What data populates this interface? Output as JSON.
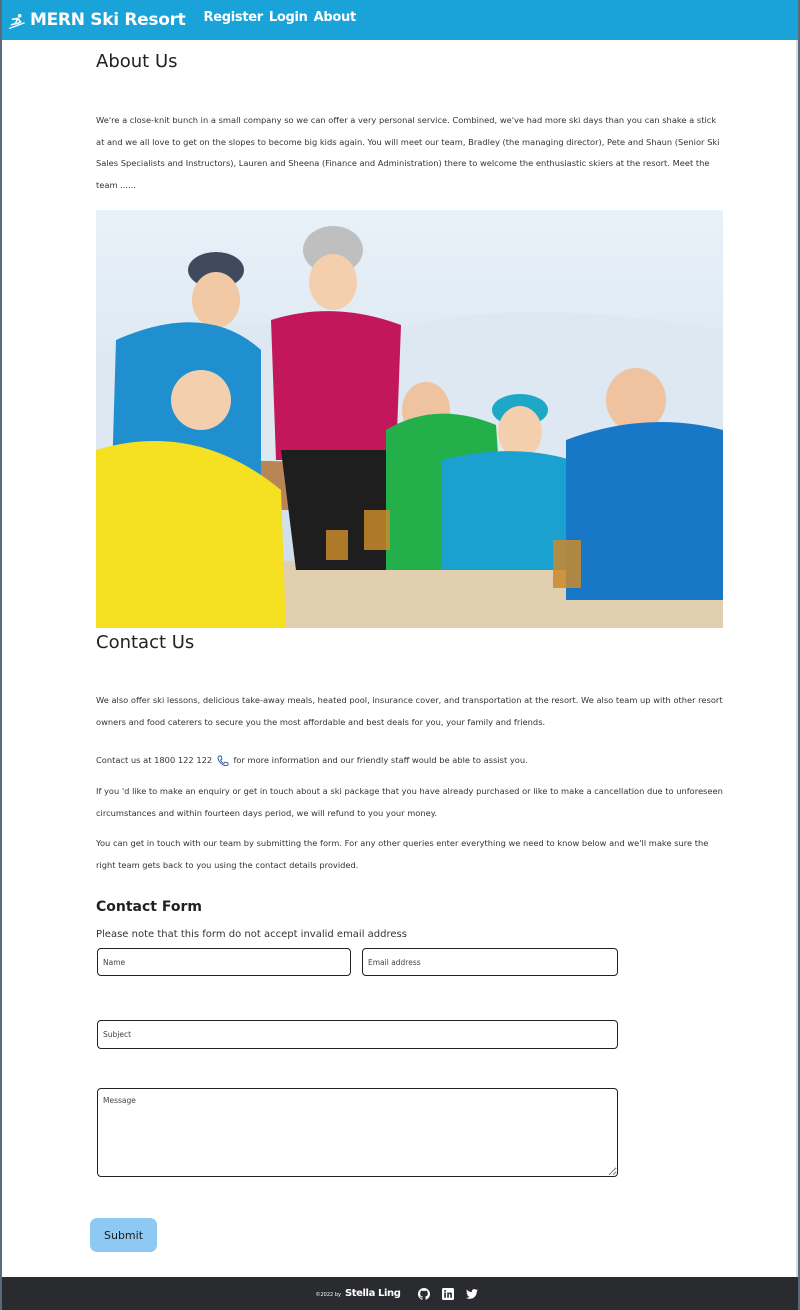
{
  "header": {
    "brand": "MERN Ski Resort",
    "brand_icon": "skier-icon",
    "nav": [
      "Register",
      "Login",
      "About"
    ],
    "colors": {
      "navbar": "#19a3d9"
    }
  },
  "about": {
    "title": "About Us",
    "text": "We're a close-knit bunch in a small company so we can offer a very personal service. Combined, we've had more ski days than you can shake a stick at and we all love to get on the slopes to become big kids again. You will meet our team, Bradley (the managing director), Pete and Shaun (Senior Ski Sales Specialists and Instructors), Lauren and Sheena (Finance and Administration) there to welcome the enthusiastic skiers at the resort. Meet the team ......"
  },
  "contact": {
    "title": "Contact Us",
    "p1": "We also offer ski lessons, delicious take-away meals, heated pool, insurance cover, and transportation at the resort. We also team up with other resort owners and food caterers to secure you the most affordable and best deals for you, your family and friends.",
    "p2_before": "Contact us at 1800 122 122",
    "p2_after": "for more information and our friendly staff would be able to assist you.",
    "p3": "If you 'd like to make an enquiry or get in touch about a ski package that you have already purchased or like to make a cancellation due to unforeseen circumstances and within fourteen days period, we will refund to you your money.",
    "p4": "You can get in touch with our team by submitting the form. For any other queries enter everything we need to know below and we'll make sure the right team gets back to you using the contact details provided."
  },
  "form": {
    "title": "Contact Form",
    "note": "Please note that this form do not accept invalid email address",
    "name_placeholder": "Name",
    "email_placeholder": "Email address",
    "subject_placeholder": "Subject",
    "message_placeholder": "Message",
    "submit_label": "Submit",
    "submit_color": "#8ec9f3"
  },
  "footer": {
    "copyright": "©2022 by",
    "author": "Stella Ling",
    "icons": [
      "github-icon",
      "linkedin-icon",
      "twitter-icon"
    ]
  }
}
